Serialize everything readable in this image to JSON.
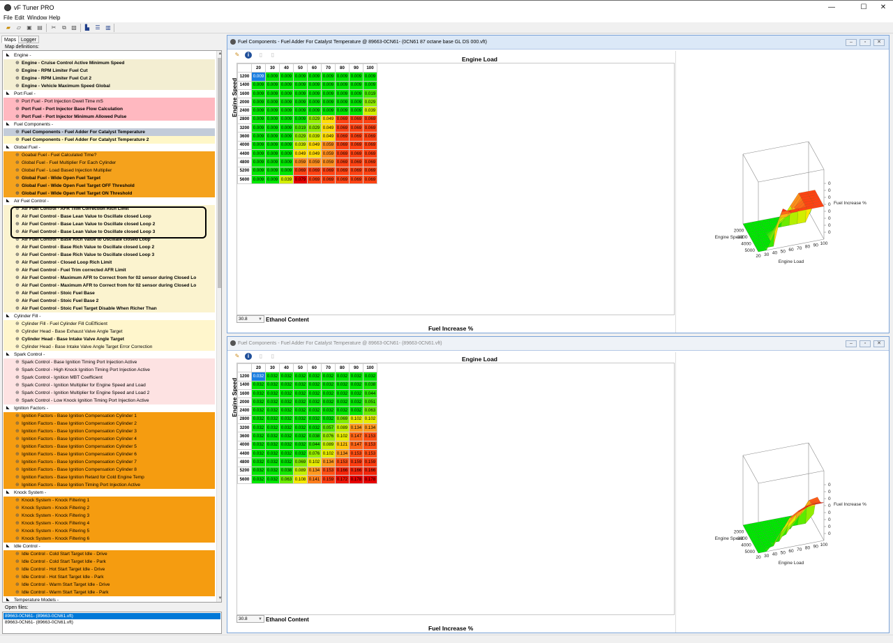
{
  "app": {
    "title": "vF Tuner PRO",
    "minimize": "—",
    "maximize": "☐",
    "close": "✕"
  },
  "menu": [
    "File",
    "Edit",
    "Window",
    "Help"
  ],
  "left_panel": {
    "tabs": [
      "Maps",
      "Logger"
    ],
    "map_definitions_label": "Map definitions:",
    "open_files_label": "Open files:",
    "open_files": [
      "89663-0CN61- (89663-0CN61.vft)",
      "89663-0CN61- (89663-0CN61.vft)"
    ],
    "tree": [
      {
        "type": "group",
        "label": "Engine -"
      },
      {
        "type": "item",
        "label": "Engine - Cruise Control Active Minimum Speed",
        "bold": true,
        "color": "#f3eed2"
      },
      {
        "type": "item",
        "label": "Engine - RPM Limiter Fuel Cut",
        "bold": true,
        "color": "#f3eed2"
      },
      {
        "type": "item",
        "label": "Engine - RPM Limiter Fuel Cut 2",
        "bold": true,
        "color": "#f3eed2"
      },
      {
        "type": "item",
        "label": "Engine - Vehicle Maximum Speed Global",
        "bold": true,
        "color": "#f3eed2"
      },
      {
        "type": "group",
        "label": "Port Fuel -"
      },
      {
        "type": "item",
        "label": "Port Fuel - Port Injection Dwell Time mS",
        "bold": false,
        "color": "#ffb8c0"
      },
      {
        "type": "item",
        "label": "Port Fuel - Port Injector Base Flow Calculation",
        "bold": true,
        "color": "#ffb8c0"
      },
      {
        "type": "item",
        "label": "Port Fuel - Port Injector Minimum Allowed Pulse",
        "bold": true,
        "color": "#ffb8c0"
      },
      {
        "type": "group",
        "label": "Fuel Components -"
      },
      {
        "type": "item",
        "label": "Fuel Components - Fuel Adder For Catalyst Temperature",
        "bold": true,
        "color": "#c3ccd9"
      },
      {
        "type": "item",
        "label": "Fuel Components - Fuel Adder For Catalyst Temperature 2",
        "bold": true,
        "color": "#fff7c8"
      },
      {
        "type": "group",
        "label": "Global Fuel -"
      },
      {
        "type": "item",
        "label": "Goabal Fuel - Fuel Calculated Time?",
        "bold": false,
        "color": "#f5a21c"
      },
      {
        "type": "item",
        "label": "Global Fuel - Fuel Multiplier For Each Cylinder",
        "bold": false,
        "color": "#f5a21c"
      },
      {
        "type": "item",
        "label": "Global Fuel - Load Based Injection Multiplier",
        "bold": false,
        "color": "#f5a21c"
      },
      {
        "type": "item",
        "label": "Global Fuel - Wide Open Fuel Target",
        "bold": true,
        "color": "#f5a21c"
      },
      {
        "type": "item",
        "label": "Global Fuel - Wide Open Fuel Target OFF Threshold",
        "bold": true,
        "color": "#f5a21c"
      },
      {
        "type": "item",
        "label": "Global Fuel - Wide Open Fuel Target ON Threshold",
        "bold": true,
        "color": "#f5a21c"
      },
      {
        "type": "group",
        "label": "Air Fuel Control -"
      },
      {
        "type": "item",
        "label": "Air Fuel Control - AFR Trim Correction Rich Limit",
        "bold": true,
        "color": "#fbf3cf"
      },
      {
        "type": "item",
        "label": "Air Fuel Control - Base Lean Value to Oscillate closed Loop",
        "bold": true,
        "color": "#fbf3cf"
      },
      {
        "type": "item",
        "label": "Air Fuel Control - Base Lean Value to Oscillate closed Loop 2",
        "bold": true,
        "color": "#fbf3cf"
      },
      {
        "type": "item",
        "label": "Air Fuel Control - Base Lean Value to Oscillate closed Loop 3",
        "bold": true,
        "color": "#fbf3cf"
      },
      {
        "type": "item",
        "label": "Air Fuel Control - Base Rich Value to Oscillate closed Loop",
        "bold": true,
        "color": "#fbf3cf"
      },
      {
        "type": "item",
        "label": "Air Fuel Control - Base Rich Value to Oscillate closed Loop 2",
        "bold": true,
        "color": "#fbf3cf"
      },
      {
        "type": "item",
        "label": "Air Fuel Control - Base Rich Value to Oscillate closed Loop 3",
        "bold": true,
        "color": "#fbf3cf"
      },
      {
        "type": "item",
        "label": "Air Fuel Control - Closed Loop Rich Limit",
        "bold": true,
        "color": "#fbf3cf"
      },
      {
        "type": "item",
        "label": "Air Fuel Control - Fuel Trim corrected AFR Limit",
        "bold": true,
        "color": "#fbf3cf"
      },
      {
        "type": "item",
        "label": "Air Fuel Control - Maximum AFR to Correct from for 02 sensor during Closed Lo",
        "bold": true,
        "color": "#fbf3cf"
      },
      {
        "type": "item",
        "label": "Air Fuel Control - Maximum AFR to Correct from for 02 sensor during Closed Lo",
        "bold": true,
        "color": "#fbf3cf"
      },
      {
        "type": "item",
        "label": "Air Fuel Control - Stoic Fuel Base",
        "bold": true,
        "color": "#fbf3cf"
      },
      {
        "type": "item",
        "label": "Air Fuel Control - Stoic Fuel Base 2",
        "bold": true,
        "color": "#fbf3cf"
      },
      {
        "type": "item",
        "label": "Air Fuel Control - Stoic Fuel Target Disable When Richer Than",
        "bold": true,
        "color": "#fbf3cf"
      },
      {
        "type": "group",
        "label": "Cylinder Fill -"
      },
      {
        "type": "item",
        "label": "Cylinder Fill - Fuel Cylinder Fill CoEfficient",
        "bold": false,
        "color": "#fff6cc"
      },
      {
        "type": "item",
        "label": "Cylinder Head - Base Exhaust Valve Angle Target",
        "bold": false,
        "color": "#fff6cc"
      },
      {
        "type": "item",
        "label": "Cylinder Head - Base Intake Valve Angle Target",
        "bold": true,
        "color": "#fff6cc"
      },
      {
        "type": "item",
        "label": "Cylinder Head - Base Intake Valve Angle Target Error Correction",
        "bold": false,
        "color": "#fff6cc"
      },
      {
        "type": "group",
        "label": "Spark Control -"
      },
      {
        "type": "item",
        "label": "Spark Control - Base Ignition Timing Port Injection Active",
        "bold": false,
        "color": "#fde2e2"
      },
      {
        "type": "item",
        "label": "Spark Control - High Knock Ignition Timing Port Injection Active",
        "bold": false,
        "color": "#fde2e2"
      },
      {
        "type": "item",
        "label": "Spark Control - Ignition MBT Coefficient",
        "bold": false,
        "color": "#fde2e2"
      },
      {
        "type": "item",
        "label": "Spark Control - Ignition Multiplier for Engine Speed and Load",
        "bold": false,
        "color": "#fde2e2"
      },
      {
        "type": "item",
        "label": "Spark Control - Ignition Multiplier for Engine Speed and Load 2",
        "bold": false,
        "color": "#fde2e2"
      },
      {
        "type": "item",
        "label": "Spark Control - Low Knock Ignition Timing Port Injection Active",
        "bold": false,
        "color": "#fde2e2"
      },
      {
        "type": "group",
        "label": "Ignition Factors -"
      },
      {
        "type": "item",
        "label": "Ignition Factors - Base Ignition Compensation Cylinder 1",
        "bold": false,
        "color": "#f59c10"
      },
      {
        "type": "item",
        "label": "Ignition Factors - Base Ignition Compensation Cylinder 2",
        "bold": false,
        "color": "#f59c10"
      },
      {
        "type": "item",
        "label": "Ignition Factors - Base Ignition Compensation Cylinder 3",
        "bold": false,
        "color": "#f59c10"
      },
      {
        "type": "item",
        "label": "Ignition Factors - Base Ignition Compensation Cylinder 4",
        "bold": false,
        "color": "#f59c10"
      },
      {
        "type": "item",
        "label": "Ignition Factors - Base Ignition Compensation Cylinder 5",
        "bold": false,
        "color": "#f59c10"
      },
      {
        "type": "item",
        "label": "Ignition Factors - Base Ignition Compensation Cylinder 6",
        "bold": false,
        "color": "#f59c10"
      },
      {
        "type": "item",
        "label": "Ignition Factors - Base Ignition Compensation Cylinder 7",
        "bold": false,
        "color": "#f59c10"
      },
      {
        "type": "item",
        "label": "Ignition Factors - Base Ignition Compensation Cylinder 8",
        "bold": false,
        "color": "#f59c10"
      },
      {
        "type": "item",
        "label": "Ignition Factors - Base Ignition Retard for Cold Engine Temp",
        "bold": false,
        "color": "#f59c10"
      },
      {
        "type": "item",
        "label": "Ignition Factors - Base Ignition Timing Port Injection Active",
        "bold": false,
        "color": "#f59c10"
      },
      {
        "type": "group",
        "label": "Knock System -"
      },
      {
        "type": "item",
        "label": "Knock System - Knock Filtering 1",
        "bold": false,
        "color": "#f59c10"
      },
      {
        "type": "item",
        "label": "Knock System - Knock Filtering 2",
        "bold": false,
        "color": "#f59c10"
      },
      {
        "type": "item",
        "label": "Knock System - Knock Filtering 3",
        "bold": false,
        "color": "#f59c10"
      },
      {
        "type": "item",
        "label": "Knock System - Knock Filtering 4",
        "bold": false,
        "color": "#f59c10"
      },
      {
        "type": "item",
        "label": "Knock System - Knock Filtering 5",
        "bold": false,
        "color": "#f59c10"
      },
      {
        "type": "item",
        "label": "Knock System - Knock Filtering 6",
        "bold": false,
        "color": "#f59c10"
      },
      {
        "type": "group",
        "label": "Idle Control -"
      },
      {
        "type": "item",
        "label": "Idle Control - Cold Start Target Idle - Drive",
        "bold": false,
        "color": "#f59c10"
      },
      {
        "type": "item",
        "label": "Idle Control - Cold Start Target Idle - Park",
        "bold": false,
        "color": "#f59c10"
      },
      {
        "type": "item",
        "label": "Idle Control - Hot Start Target Idle - Drive",
        "bold": false,
        "color": "#f59c10"
      },
      {
        "type": "item",
        "label": "Idle Control - Hot Start Target Idle - Park",
        "bold": false,
        "color": "#f59c10"
      },
      {
        "type": "item",
        "label": "Idle Control - Warm Start Target Idle - Drive",
        "bold": false,
        "color": "#f59c10"
      },
      {
        "type": "item",
        "label": "Idle Control - Warm Start Target Idle - Park",
        "bold": false,
        "color": "#f59c10"
      },
      {
        "type": "group",
        "label": "Temperature Models -"
      }
    ]
  },
  "windows": [
    {
      "title": "Fuel Components - Fuel Adder For Catalyst Temperature @ 89663-0CN61- (0CN61 87 octane base GL DS  000.vft)",
      "x_axis_title": "Engine Load",
      "y_axis_title": "Engine Speed",
      "z_axis_title": "Fuel Increase %",
      "ethanol_value": "30.8",
      "ethanol_label": "Ethanol Content",
      "col_headers": [
        "20",
        "30",
        "40",
        "50",
        "60",
        "70",
        "80",
        "90",
        "100"
      ],
      "row_headers": [
        "1200",
        "1400",
        "1600",
        "2000",
        "2400",
        "2800",
        "3200",
        "3600",
        "4000",
        "4400",
        "4800",
        "5200",
        "5600"
      ],
      "cells": [
        [
          "0.009",
          "0.009",
          "0.009",
          "0.009",
          "0.009",
          "0.009",
          "0.009",
          "0.009",
          "0.009"
        ],
        [
          "0.009",
          "0.009",
          "0.009",
          "0.009",
          "0.009",
          "0.009",
          "0.009",
          "0.009",
          "0.009"
        ],
        [
          "0.009",
          "0.009",
          "0.009",
          "0.009",
          "0.009",
          "0.009",
          "0.009",
          "0.009",
          "0.019"
        ],
        [
          "0.009",
          "0.009",
          "0.009",
          "0.009",
          "0.009",
          "0.009",
          "0.009",
          "0.009",
          "0.029"
        ],
        [
          "0.009",
          "0.009",
          "0.009",
          "0.009",
          "0.009",
          "0.009",
          "0.009",
          "0.009",
          "0.039"
        ],
        [
          "0.009",
          "0.009",
          "0.009",
          "0.009",
          "0.029",
          "0.049",
          "0.069",
          "0.069",
          "0.069"
        ],
        [
          "0.009",
          "0.009",
          "0.009",
          "0.019",
          "0.029",
          "0.049",
          "0.069",
          "0.069",
          "0.069"
        ],
        [
          "0.009",
          "0.009",
          "0.009",
          "0.029",
          "0.039",
          "0.049",
          "0.069",
          "0.069",
          "0.069"
        ],
        [
          "0.009",
          "0.009",
          "0.009",
          "0.039",
          "0.049",
          "0.059",
          "0.069",
          "0.069",
          "0.069"
        ],
        [
          "0.009",
          "0.009",
          "0.009",
          "0.049",
          "0.049",
          "0.059",
          "0.069",
          "0.069",
          "0.069"
        ],
        [
          "0.009",
          "0.009",
          "0.009",
          "0.059",
          "0.059",
          "0.059",
          "0.069",
          "0.069",
          "0.069"
        ],
        [
          "0.009",
          "0.009",
          "0.009",
          "0.069",
          "0.069",
          "0.069",
          "0.069",
          "0.069",
          "0.069"
        ],
        [
          "0.009",
          "0.009",
          "0.039",
          "0.079",
          "0.069",
          "0.069",
          "0.069",
          "0.069",
          "0.069"
        ]
      ],
      "plot_x_ticks": [
        "20",
        "30",
        "40",
        "50",
        "60",
        "70",
        "80",
        "90",
        "100"
      ],
      "plot_y_ticks": [
        "2000",
        "3000",
        "4000",
        "5000"
      ],
      "plot_z_ticks": [
        "0",
        "0",
        "0",
        "0",
        "0",
        "0",
        "0",
        "0"
      ]
    },
    {
      "title": "Fuel Components - Fuel Adder For Catalyst Temperature @ 89663-0CN61- (89663-0CN61.vft)",
      "x_axis_title": "Engine Load",
      "y_axis_title": "Engine Speed",
      "z_axis_title": "Fuel Increase %",
      "ethanol_value": "30.8",
      "ethanol_label": "Ethanol Content",
      "col_headers": [
        "20",
        "30",
        "40",
        "50",
        "60",
        "70",
        "80",
        "90",
        "100"
      ],
      "row_headers": [
        "1200",
        "1400",
        "1600",
        "2000",
        "2400",
        "2800",
        "3200",
        "3600",
        "4000",
        "4400",
        "4800",
        "5200",
        "5600"
      ],
      "cells": [
        [
          "0.032",
          "0.032",
          "0.032",
          "0.032",
          "0.032",
          "0.032",
          "0.032",
          "0.032",
          "0.032"
        ],
        [
          "0.032",
          "0.032",
          "0.032",
          "0.032",
          "0.032",
          "0.032",
          "0.032",
          "0.032",
          "0.038"
        ],
        [
          "0.032",
          "0.032",
          "0.032",
          "0.032",
          "0.032",
          "0.032",
          "0.032",
          "0.032",
          "0.044"
        ],
        [
          "0.032",
          "0.032",
          "0.032",
          "0.032",
          "0.032",
          "0.032",
          "0.032",
          "0.032",
          "0.051"
        ],
        [
          "0.032",
          "0.032",
          "0.032",
          "0.032",
          "0.032",
          "0.032",
          "0.032",
          "0.032",
          "0.063"
        ],
        [
          "0.032",
          "0.032",
          "0.032",
          "0.032",
          "0.032",
          "0.032",
          "0.069",
          "0.102",
          "0.102"
        ],
        [
          "0.032",
          "0.032",
          "0.032",
          "0.032",
          "0.032",
          "0.057",
          "0.089",
          "0.134",
          "0.134"
        ],
        [
          "0.032",
          "0.032",
          "0.032",
          "0.032",
          "0.038",
          "0.076",
          "0.102",
          "0.147",
          "0.153"
        ],
        [
          "0.032",
          "0.032",
          "0.032",
          "0.032",
          "0.044",
          "0.089",
          "0.121",
          "0.147",
          "0.153"
        ],
        [
          "0.032",
          "0.032",
          "0.032",
          "0.032",
          "0.076",
          "0.102",
          "0.134",
          "0.153",
          "0.153"
        ],
        [
          "0.032",
          "0.032",
          "0.032",
          "0.069",
          "0.102",
          "0.134",
          "0.153",
          "0.159",
          "0.159"
        ],
        [
          "0.032",
          "0.032",
          "0.038",
          "0.089",
          "0.134",
          "0.153",
          "0.166",
          "0.166",
          "0.166"
        ],
        [
          "0.032",
          "0.032",
          "0.063",
          "0.108",
          "0.141",
          "0.159",
          "0.172",
          "0.178",
          "0.178"
        ]
      ],
      "plot_x_ticks": [
        "20",
        "30",
        "40",
        "50",
        "60",
        "70",
        "80",
        "90",
        "100"
      ],
      "plot_y_ticks": [
        "2000",
        "3000",
        "4000",
        "5000"
      ],
      "plot_z_ticks": [
        "0",
        "0",
        "0",
        "0",
        "0",
        "0",
        "0",
        "0"
      ]
    }
  ]
}
